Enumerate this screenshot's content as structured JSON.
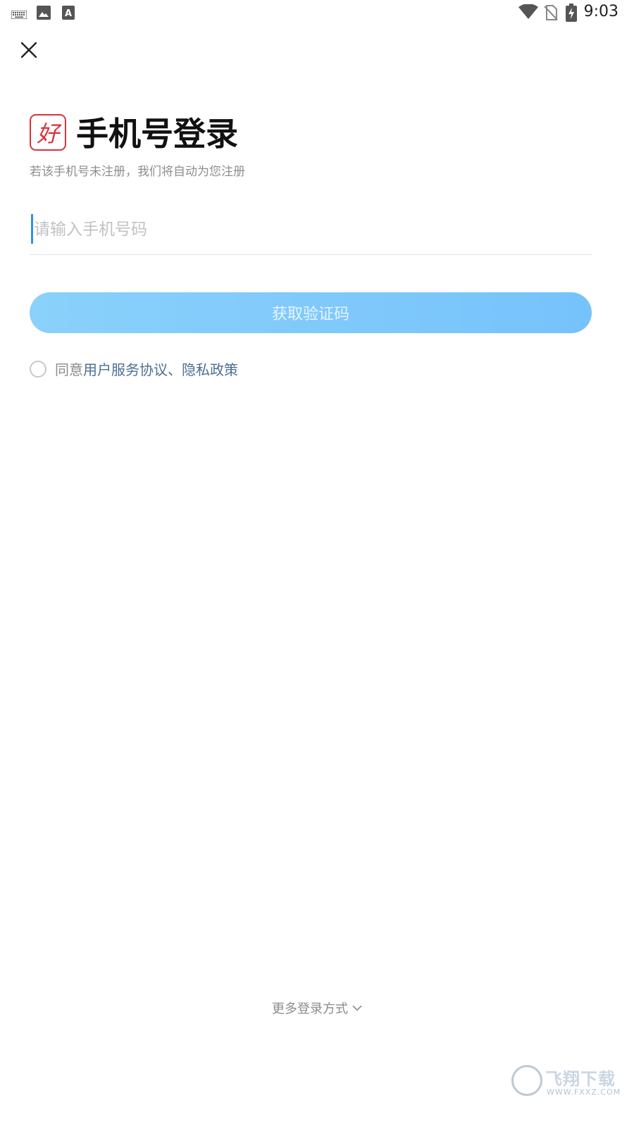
{
  "status_bar": {
    "time": "9:03",
    "left_icons": [
      "keyboard-icon",
      "image-icon",
      "text-a-icon"
    ],
    "right_icons": [
      "wifi-icon",
      "no-sim-icon",
      "battery-charging-icon"
    ]
  },
  "header": {
    "close_icon": "close-icon"
  },
  "login": {
    "logo_char": "好",
    "title": "手机号登录",
    "subtitle": "若该手机号未注册，我们将自动为您注册",
    "phone_placeholder": "请输入手机号码",
    "phone_value": "",
    "get_code_label": "获取验证码",
    "agreement_prefix": "同意",
    "agreement_link_1": "用户服务协议",
    "agreement_separator": "、",
    "agreement_link_2": "隐私政策",
    "agreement_checked": false
  },
  "footer": {
    "more_login_label": "更多登录方式"
  },
  "watermark": {
    "text_cn": "飞翔下载",
    "text_en": "WWW.FXXZ.COM"
  },
  "colors": {
    "primary_button": "#7ec8fb",
    "link": "#4d6f93",
    "logo": "#d9343a",
    "caret": "#2f8ef0"
  }
}
